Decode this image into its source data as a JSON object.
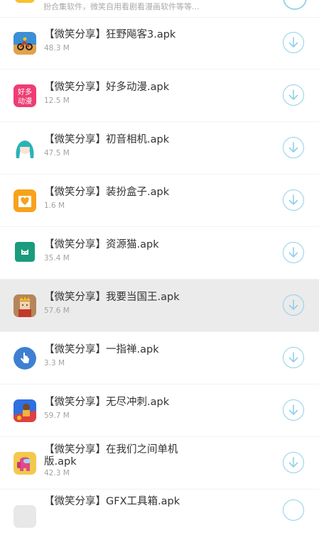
{
  "top_item": {
    "description": "扮合集软件，微笑自用看剧看漫画软件等等..."
  },
  "items": [
    {
      "name": "【微笑分享】狂野飚客3.apk",
      "size": "48.3 M",
      "icon": "motorbike-game-icon"
    },
    {
      "name": "【微笑分享】好多动漫.apk",
      "size": "12.5 M",
      "icon": "haoduo-dongman-icon"
    },
    {
      "name": "【微笑分享】初音相机.apk",
      "size": "47.5 M",
      "icon": "hatsune-miku-icon"
    },
    {
      "name": "【微笑分享】装扮盒子.apk",
      "size": "1.6 M",
      "icon": "heart-box-icon"
    },
    {
      "name": "【微笑分享】资源猫.apk",
      "size": "35.4 M",
      "icon": "cat-icon"
    },
    {
      "name": "【微笑分享】我要当国王.apk",
      "size": "57.6 M",
      "icon": "king-game-icon"
    },
    {
      "name": "【微笑分享】一指禅.apk",
      "size": "3.3 M",
      "icon": "finger-tap-icon"
    },
    {
      "name": "【微笑分享】无尽冲刺.apk",
      "size": "59.7 M",
      "icon": "endless-run-icon"
    },
    {
      "name": "【微笑分享】在我们之间单机版.apk",
      "size": "42.3 M",
      "icon": "among-us-icon"
    },
    {
      "name": "【微笑分享】GFX工具箱.apk",
      "size": "",
      "icon": "gfx-tool-icon"
    }
  ],
  "colors": {
    "download_ring": "#8fd0ea",
    "highlight_row": "#ebebeb",
    "title_text": "#333333",
    "size_text": "#a3a3a3"
  }
}
